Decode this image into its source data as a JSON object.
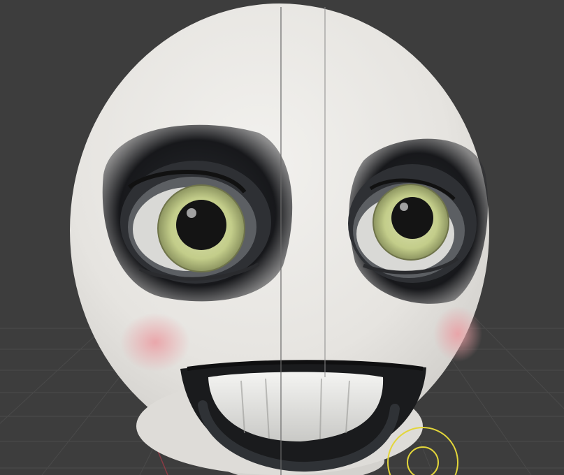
{
  "scene": {
    "subject": "stylized-white-head",
    "colors": {
      "background": "#3d3d3d",
      "grid": "#4a4a4a",
      "axis_red": "#8a3a44",
      "skin": "#e8e6e2",
      "eye_shadow": "#1d1f22",
      "iris": "#c6d08f",
      "pupil": "#141414",
      "blush": "#e8a2a6",
      "cursor_ring": "#e3d63a"
    }
  }
}
